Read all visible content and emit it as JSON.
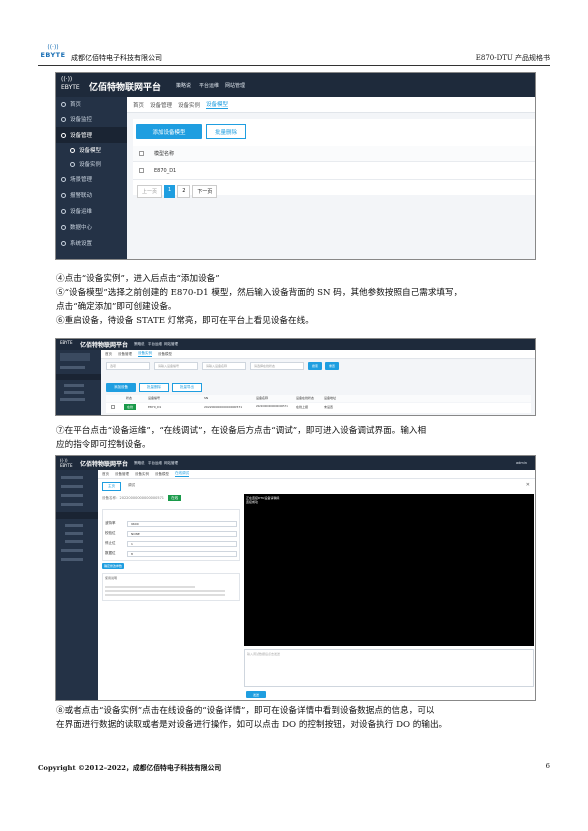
{
  "header": {
    "logo_text": "EBYTE",
    "company": "成都亿佰特电子科技有限公司",
    "doc_title": "E870-DTU 产品规格书"
  },
  "shot1": {
    "platform_title": "亿佰特物联网平台",
    "top_nav": [
      "策略说",
      "平台运维",
      "网站管理"
    ],
    "sidebar": [
      {
        "label": "首页",
        "icon": "home-icon"
      },
      {
        "label": "设备监控",
        "icon": "monitor-icon"
      },
      {
        "label": "设备管理",
        "icon": "device-icon"
      },
      {
        "label": "设备模型",
        "icon": "circle-icon"
      },
      {
        "label": "设备实例",
        "icon": "circle-icon"
      },
      {
        "label": "场景管理",
        "icon": "scene-icon"
      },
      {
        "label": "报警联动",
        "icon": "alarm-icon"
      },
      {
        "label": "设备运维",
        "icon": "gear-icon"
      },
      {
        "label": "数据中心",
        "icon": "data-icon"
      },
      {
        "label": "系统设置",
        "icon": "settings-icon"
      }
    ],
    "breadcrumb": [
      "首页",
      "设备管理",
      "设备实例",
      "设备模型"
    ],
    "add_button": "添加设备模型",
    "batch_delete": "批量删除",
    "col_header": "模型名称",
    "row_value": "E870_D1",
    "pagination": {
      "prev": "上一页",
      "p1": "1",
      "p2": "2",
      "next": "下一页"
    }
  },
  "text1": [
    "④点击“设备实例”，进入后点击“添加设备”",
    "⑤“设备模型”选择之前创建的 E870-D1 模型，然后输入设备背面的 SN 码，其他参数按照自己需求填写，",
    "点击“确定添加”即可创建设备。",
    "⑥重启设备，待设备 STATE 灯常亮，即可在平台上看见设备在线。"
  ],
  "shot2": {
    "platform_title": "亿佰特物联网平台",
    "top_nav": [
      "策略说",
      "平台运维",
      "网站管理"
    ],
    "breadcrumb": [
      "首页",
      "设备管理",
      "设备实例",
      "设备模型"
    ],
    "filters": {
      "f1": "选项",
      "f2": "请输入设备编号",
      "f3": "请输入设备名称",
      "f4": "请选择在线状态",
      "search": "搜索",
      "reset": "重置"
    },
    "buttons": [
      "添加设备",
      "批量删除",
      "批量导出"
    ],
    "headers": [
      "状态",
      "设备编号",
      "SN",
      "设备名称",
      "设备在线状态",
      "设备地址"
    ],
    "row": {
      "status": "在线",
      "model": "E870_D1",
      "sn": "20220000000000000571",
      "name": "20220000000000000571",
      "online": "在线上报",
      "addr": "未设置"
    }
  },
  "text2": [
    "⑦在平台点击“设备运维”，“在线调试”，在设备后方点击“调试”，即可进入设备调试界面。输入相",
    "应的指令即可控制设备。"
  ],
  "shot3": {
    "platform_title": "亿佰特物联网平台",
    "top_nav": [
      "策略说",
      "平台运维",
      "网站管理"
    ],
    "user": "admin",
    "tabs": [
      "首页",
      "设备管理",
      "设备实例",
      "设备模型",
      "在线调试"
    ],
    "subtabs": [
      "主页",
      "调试"
    ],
    "device_line": "设备名称：20220000000000000571",
    "online_tag": "在线",
    "params": [
      {
        "label": "波特率",
        "value": "9600"
      },
      {
        "label": "校验位",
        "value": "NONE"
      },
      {
        "label": "停止位",
        "value": "1"
      },
      {
        "label": "数据位",
        "value": "8"
      }
    ],
    "confirm": "确定修改参数",
    "notes_title": "使用说明",
    "terminal_lines": [
      "正在连接DTU设备请稍候",
      "连接成功"
    ],
    "input_placeholder": "输入调试数据后点击发送",
    "send": "发送"
  },
  "text3": [
    "⑧或者点击“设备实例”点击在线设备的“设备详情”，即可在设备详情中看到设备数据点的信息，可以",
    "在界面进行数据的读取或者是对设备进行操作，如可以点击 DO 的控制按钮，对设备执行 DO 的输出。"
  ],
  "footer": {
    "copyright": "Copyright ©2012–2022，成都亿佰特电子科技有限公司",
    "page": "6"
  }
}
